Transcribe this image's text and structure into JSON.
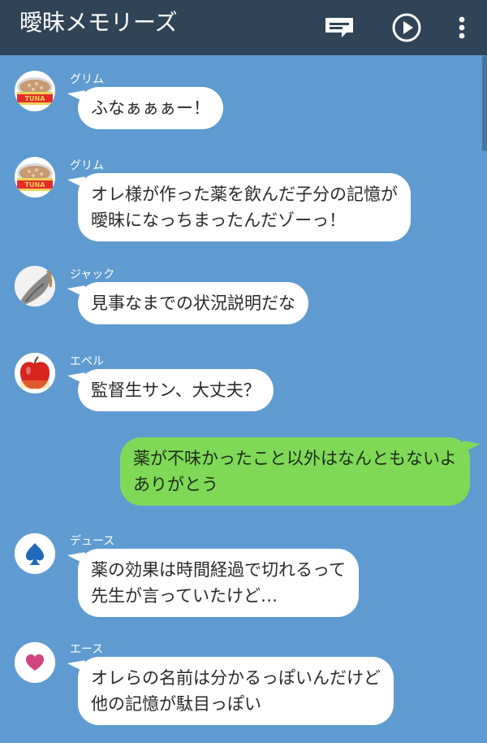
{
  "header": {
    "title": "曖昧メモリーズ",
    "icons": [
      "chat-icon",
      "play-icon",
      "more-icon"
    ]
  },
  "colors": {
    "header_bg": "#2f4456",
    "chat_bg": "#5f9bd0",
    "bubble_left": "#ffffff",
    "bubble_right": "#7fd957"
  },
  "messages": [
    {
      "sender": "グリム",
      "avatar": "tuna-can",
      "side": "left",
      "lines": [
        "ふなぁぁぁー！"
      ]
    },
    {
      "sender": "グリム",
      "avatar": "tuna-can",
      "side": "left",
      "lines": [
        "オレ様が作った薬を飲んだ子分の記憶が",
        "曖昧になっちまったんだゾーっ！"
      ]
    },
    {
      "sender": "ジャック",
      "avatar": "wolf-tail",
      "side": "left",
      "lines": [
        "見事なまでの状況説明だな"
      ]
    },
    {
      "sender": "エペル",
      "avatar": "apple",
      "side": "left",
      "lines": [
        "監督生サン、大丈夫？"
      ]
    },
    {
      "sender": "",
      "avatar": "",
      "side": "right",
      "lines": [
        "薬が不味かったこと以外はなんともないよ",
        "ありがとう"
      ]
    },
    {
      "sender": "デュース",
      "avatar": "spade",
      "side": "left",
      "lines": [
        "薬の効果は時間経過で切れるって",
        "先生が言っていたけど…"
      ]
    },
    {
      "sender": "エース",
      "avatar": "heart",
      "side": "left",
      "lines": [
        "オレらの名前は分かるっぽいんだけど",
        "他の記憶が駄目っぽい"
      ]
    }
  ]
}
